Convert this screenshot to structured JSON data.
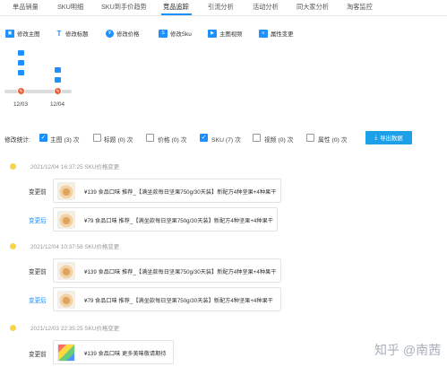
{
  "tabs": [
    {
      "label": "单品销量",
      "active": false
    },
    {
      "label": "SKU明细",
      "active": false
    },
    {
      "label": "SKU到手价趋势",
      "active": false
    },
    {
      "label": "竞品追踪",
      "active": true
    },
    {
      "label": "引流分析",
      "active": false
    },
    {
      "label": "活动分析",
      "active": false
    },
    {
      "label": "同大家分析",
      "active": false
    },
    {
      "label": "淘客监控",
      "active": false
    }
  ],
  "legend": [
    {
      "label": "修改主图",
      "icon": "image-icon"
    },
    {
      "label": "修改标题",
      "icon": "title-icon"
    },
    {
      "label": "修改价格",
      "icon": "price-icon"
    },
    {
      "label": "修改Sku",
      "icon": "sku-icon"
    },
    {
      "label": "主图视频",
      "icon": "video-icon"
    },
    {
      "label": "属性变更",
      "icon": "property-icon"
    }
  ],
  "timeline": {
    "points": [
      {
        "date": "12/03",
        "changes": 3
      },
      {
        "date": "12/04",
        "changes": 2
      }
    ],
    "marker_color": "#e8603c",
    "icon_color": "#1e90ff"
  },
  "filter": {
    "label": "修改统计:",
    "options": [
      {
        "name": "主图",
        "count": "(3)",
        "unit": "次",
        "checked": true
      },
      {
        "name": "标题",
        "count": "(0)",
        "unit": "次",
        "checked": false
      },
      {
        "name": "价格",
        "count": "(0)",
        "unit": "次",
        "checked": false
      },
      {
        "name": "SKU",
        "count": "(7)",
        "unit": "次",
        "checked": true
      },
      {
        "name": "视频",
        "count": "(0)",
        "unit": "次",
        "checked": false
      },
      {
        "name": "属性",
        "count": "(0)",
        "unit": "次",
        "checked": false
      }
    ],
    "export_label": "导出数据"
  },
  "entries": [
    {
      "time": "2021/12/04 16:37:25 SKU价格变更",
      "before_label": "变更前",
      "before_text": "¥139   食品口味 推荐_【满坐款每日坚果750g/30天装】新配方4种坚果+4种果干",
      "after_label": "变更后",
      "after_text": "¥79   食品口味 推荐_【满坐款每日坚果750g/30天装】新配方4种坚果+4种果干"
    },
    {
      "time": "2021/12/04 10:37:58 SKU价格变更",
      "before_label": "变更前",
      "before_text": "¥139   食品口味 推荐_【满坐款每日坚果750g/30天装】新配方4种坚果+4种果干",
      "after_label": "变更后",
      "after_text": "¥79   食品口味 推荐_【满坐款每日坚果750g/30天装】新配方4种坚果+4种果干"
    },
    {
      "time": "2021/12/03 22:35:25 SKU价格变更",
      "before_label": "变更前",
      "before_text": "¥139   食品口味 更多美味敬请期待"
    }
  ],
  "colors": {
    "accent": "#1890ff",
    "timeline_dot": "#f6d54a",
    "export_button": "#1ea0e8"
  },
  "watermark": "知乎 @南茜"
}
